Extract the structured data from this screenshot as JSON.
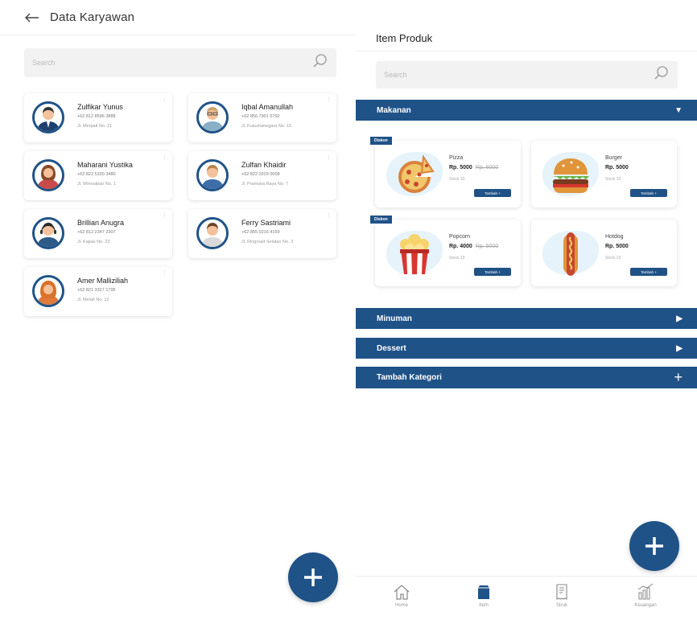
{
  "left": {
    "header": {
      "title": "Data Karyawan"
    },
    "search": {
      "placeholder": "Search"
    },
    "employees": [
      {
        "name": "Zulfikar Yunus",
        "phone": "+62 812 8596 3888",
        "address": "Jl. Merpati No. 21"
      },
      {
        "name": "Iqbal Amanullah",
        "phone": "+62 856 7901 5792",
        "address": "Jl. Kusumanegara No. 15"
      },
      {
        "name": "Maharani Yustika",
        "phone": "+62 822 5330 3480",
        "address": "Jl. Wirosaban No. 1"
      },
      {
        "name": "Zulfan Khaidir",
        "phone": "+62 822 0203 0008",
        "address": "Jl. Pramuka Raya No. 7"
      },
      {
        "name": "Brillian Anugra",
        "phone": "+62 812 2347 2307",
        "address": "Jl. Kapas No. 23"
      },
      {
        "name": "Ferry Sastriami",
        "phone": "+62 855 0216 4159",
        "address": "Jl. Ringroad Selatan No. 3"
      },
      {
        "name": "Amer Malliziliah",
        "phone": "+62 821 3327 1795",
        "address": "Jl. Melati No. 12"
      }
    ]
  },
  "right": {
    "header": {
      "title": "Item Produk"
    },
    "search": {
      "placeholder": "Search"
    },
    "categories": {
      "makanan": "Makanan",
      "minuman": "Minuman",
      "dessert": "Dessert",
      "tambah": "Tambah Kategori"
    },
    "products": [
      {
        "name": "Pizza",
        "price": "Rp. 5000",
        "old_price": "Rp. 6000",
        "stock": "Stock 10",
        "add_label": "Tambah +",
        "badge": "Diskon",
        "icon": "pizza-icon"
      },
      {
        "name": "Burger",
        "price": "Rp. 5000",
        "old_price": "",
        "stock": "Stock 10",
        "add_label": "Tambah +",
        "badge": "",
        "icon": "burger-icon"
      },
      {
        "name": "Popcorn",
        "price": "Rp. 4000",
        "old_price": "Rp. 5000",
        "stock": "Stock 10",
        "add_label": "Tambah +",
        "badge": "Diskon",
        "icon": "popcorn-icon"
      },
      {
        "name": "Hotdog",
        "price": "Rp. 5000",
        "old_price": "",
        "stock": "Stock 10",
        "add_label": "Tambah +",
        "badge": "",
        "icon": "hotdog-icon"
      }
    ],
    "nav": [
      {
        "label": "Home",
        "icon": "home-icon"
      },
      {
        "label": "Item",
        "icon": "item-icon"
      },
      {
        "label": "Struk",
        "icon": "receipt-icon"
      },
      {
        "label": "Keuangan",
        "icon": "finance-icon"
      }
    ]
  },
  "colors": {
    "primary": "#1f5287",
    "search_bg": "#f2f2f2",
    "blob": "#e6f3fb"
  }
}
